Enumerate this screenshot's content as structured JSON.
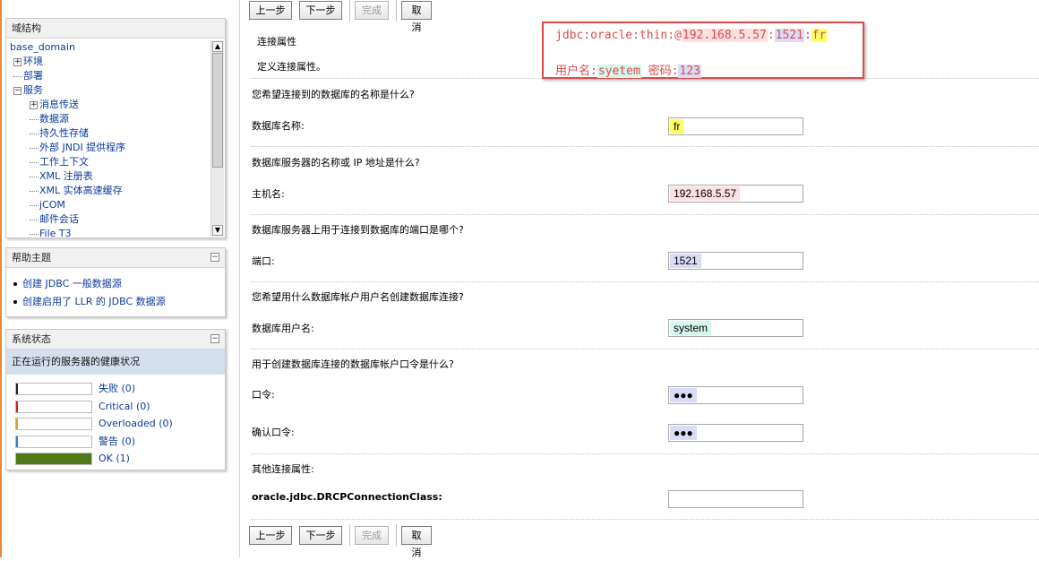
{
  "colors": {
    "accent_link": "#0b3b9e",
    "status_fail": "#222222",
    "status_critical": "#d42020",
    "status_overloaded": "#d8a436",
    "status_warning": "#3a7bd5",
    "status_ok": "#507a1a",
    "callout_red": "#e04a4a",
    "hl_yellow": "#ffff66",
    "hl_pink": "#fde0e0",
    "hl_lavender": "#d9dcf7",
    "hl_mint": "#d4f7ee"
  },
  "domain_panel": {
    "title": "域结构",
    "collapse_icon": "minus-box-icon",
    "tree": [
      {
        "label": "base_domain",
        "indent": 0,
        "toggle": ""
      },
      {
        "label": "环境",
        "indent": 1,
        "toggle": "+"
      },
      {
        "label": "部署",
        "indent": 1,
        "toggle": ""
      },
      {
        "label": "服务",
        "indent": 1,
        "toggle": "-"
      },
      {
        "label": "消息传送",
        "indent": 2,
        "toggle": "+"
      },
      {
        "label": "数据源",
        "indent": 2,
        "toggle": ""
      },
      {
        "label": "持久性存储",
        "indent": 2,
        "toggle": ""
      },
      {
        "label": "外部 JNDI 提供程序",
        "indent": 2,
        "toggle": ""
      },
      {
        "label": "工作上下文",
        "indent": 2,
        "toggle": ""
      },
      {
        "label": "XML 注册表",
        "indent": 2,
        "toggle": ""
      },
      {
        "label": "XML 实体高速缓存",
        "indent": 2,
        "toggle": ""
      },
      {
        "label": "jCOM",
        "indent": 2,
        "toggle": ""
      },
      {
        "label": "邮件会话",
        "indent": 2,
        "toggle": ""
      },
      {
        "label": "File T3",
        "indent": 2,
        "toggle": ""
      }
    ]
  },
  "help_panel": {
    "title": "帮助主题",
    "items": [
      "创建 JDBC 一般数据源",
      "创建启用了 LLR 的 JDBC 数据源"
    ]
  },
  "status_panel": {
    "title": "系统状态",
    "subtitle": "正在运行的服务器的健康状况",
    "rows": [
      {
        "label": "失败 (0)",
        "color": "#222222",
        "fill": 0
      },
      {
        "label": "Critical (0)",
        "color": "#d42020",
        "fill": 0
      },
      {
        "label": "Overloaded (0)",
        "color": "#d8a436",
        "fill": 0
      },
      {
        "label": "警告 (0)",
        "color": "#3a7bd5",
        "fill": 0
      },
      {
        "label": "OK (1)",
        "color": "#507a1a",
        "fill": 1
      }
    ]
  },
  "toolbar": {
    "back": "上一步",
    "next": "下一步",
    "finish": "完成",
    "cancel": "取消"
  },
  "form": {
    "section_title": "连接属性",
    "section_desc": "定义连接属性。",
    "q_dbname": "您希望连接到的数据库的名称是什么?",
    "label_dbname": "数据库名称:",
    "value_dbname": "fr",
    "q_host": "数据库服务器的名称或 IP 地址是什么?",
    "label_host": "主机名:",
    "value_host": "192.168.5.57",
    "q_port": "数据库服务器上用于连接到数据库的端口是哪个?",
    "label_port": "端口:",
    "value_port": "1521",
    "q_user": "您希望用什么数据库帐户用户名创建数据库连接?",
    "label_user": "数据库用户名:",
    "value_user": "system",
    "q_password": "用于创建数据库连接的数据库帐户口令是什么?",
    "label_password": "口令:",
    "value_password": "●●●",
    "label_confirm": "确认口令:",
    "value_confirm": "●●●",
    "other_title": "其他连接属性:",
    "label_drcp": "oracle.jdbc.DRCPConnectionClass:",
    "value_drcp": ""
  },
  "callout": {
    "url_prefix": "jdbc:oracle:thin:@",
    "url_host": "192.168.5.57",
    "url_colon1": ":",
    "url_port": "1521",
    "url_colon2": ":",
    "url_sid": "fr",
    "user_label": "用户名:",
    "user_value": "syetem",
    "pwd_label": "密码:",
    "pwd_value": "123"
  }
}
